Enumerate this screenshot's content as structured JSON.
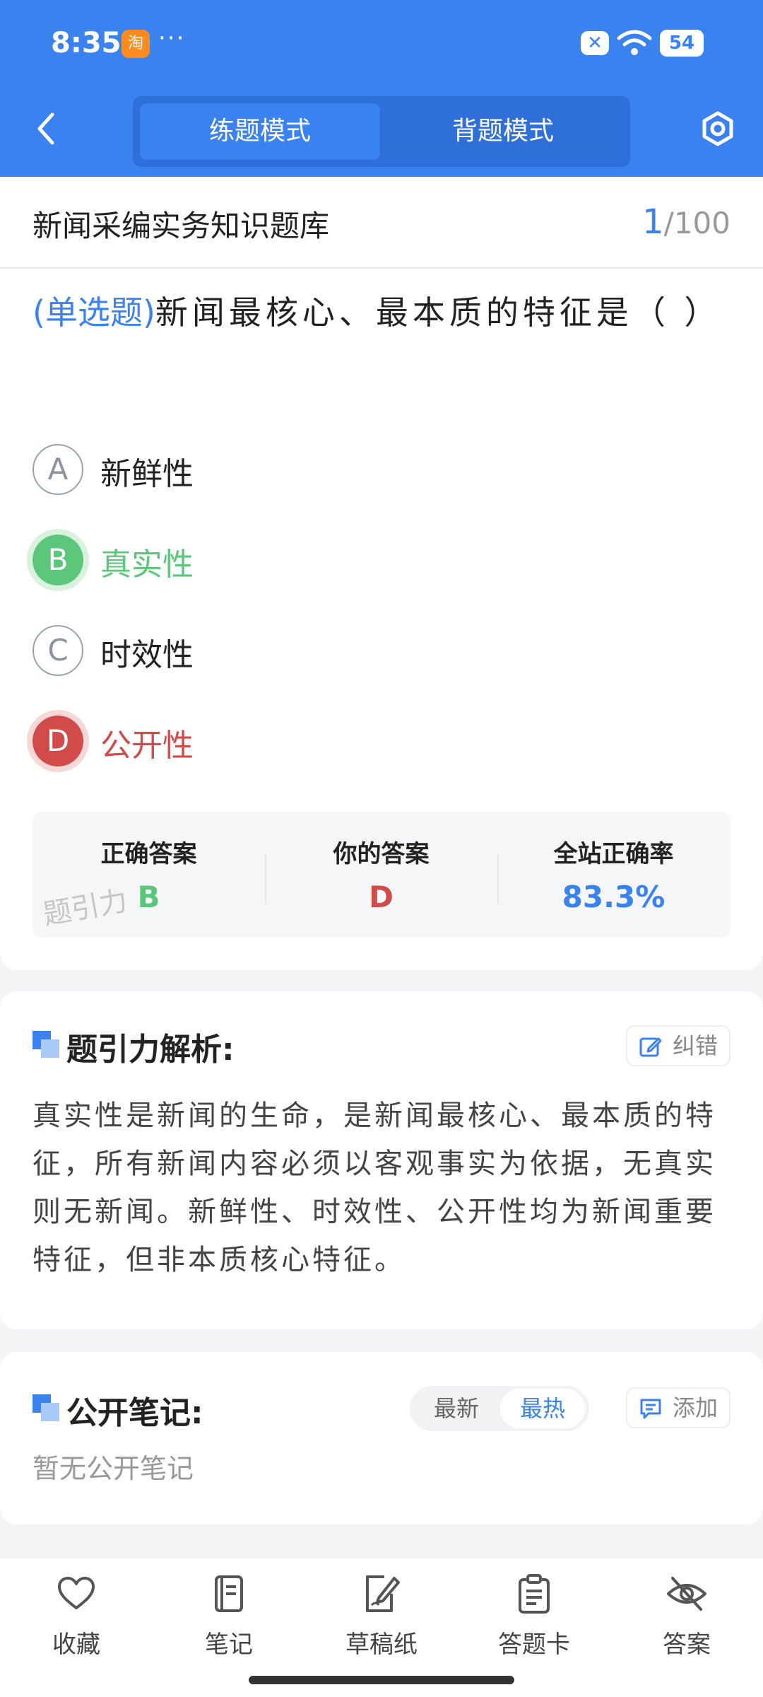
{
  "status": {
    "time": "8:35",
    "app_badge": "淘",
    "dots": "···",
    "battery": "54"
  },
  "header": {
    "tabs": [
      "练题模式",
      "背题模式"
    ],
    "active_tab": 0
  },
  "question_card": {
    "bank_title": "新闻采编实务知识题库",
    "progress_current": "1",
    "progress_total": "/100",
    "question_type": "(单选题)",
    "question_text": "新闻最核心、最本质的特征是（ ）",
    "options": [
      {
        "letter": "A",
        "text": "新鲜性",
        "state": "normal"
      },
      {
        "letter": "B",
        "text": "真实性",
        "state": "correct"
      },
      {
        "letter": "C",
        "text": "时效性",
        "state": "normal"
      },
      {
        "letter": "D",
        "text": "公开性",
        "state": "wrong"
      }
    ],
    "answer_summary": {
      "correct_label": "正确答案",
      "correct_value": "B",
      "yours_label": "你的答案",
      "yours_value": "D",
      "rate_label": "全站正确率",
      "rate_value": "83.3%"
    },
    "watermark": "题引力"
  },
  "analysis": {
    "title": "题引力解析:",
    "report_label": "纠错",
    "text": "真实性是新闻的生命，是新闻最核心、最本质的特征，所有新闻内容必须以客观事实为依据，无真实则无新闻。新鲜性、时效性、公开性均为新闻重要特征，但非本质核心特征。"
  },
  "notes": {
    "title": "公开笔记:",
    "sort_options": [
      "最新",
      "最热"
    ],
    "active_sort": 1,
    "add_label": "添加",
    "empty_text": "暂无公开笔记"
  },
  "bottom_nav": [
    {
      "label": "收藏",
      "icon": "heart-icon"
    },
    {
      "label": "笔记",
      "icon": "notebook-icon"
    },
    {
      "label": "草稿纸",
      "icon": "draft-icon"
    },
    {
      "label": "答题卡",
      "icon": "answer-sheet-icon"
    },
    {
      "label": "答案",
      "icon": "eye-off-icon"
    }
  ],
  "colors": {
    "primary": "#3a82ef",
    "correct": "#5cc77a",
    "wrong": "#d24b4b"
  }
}
